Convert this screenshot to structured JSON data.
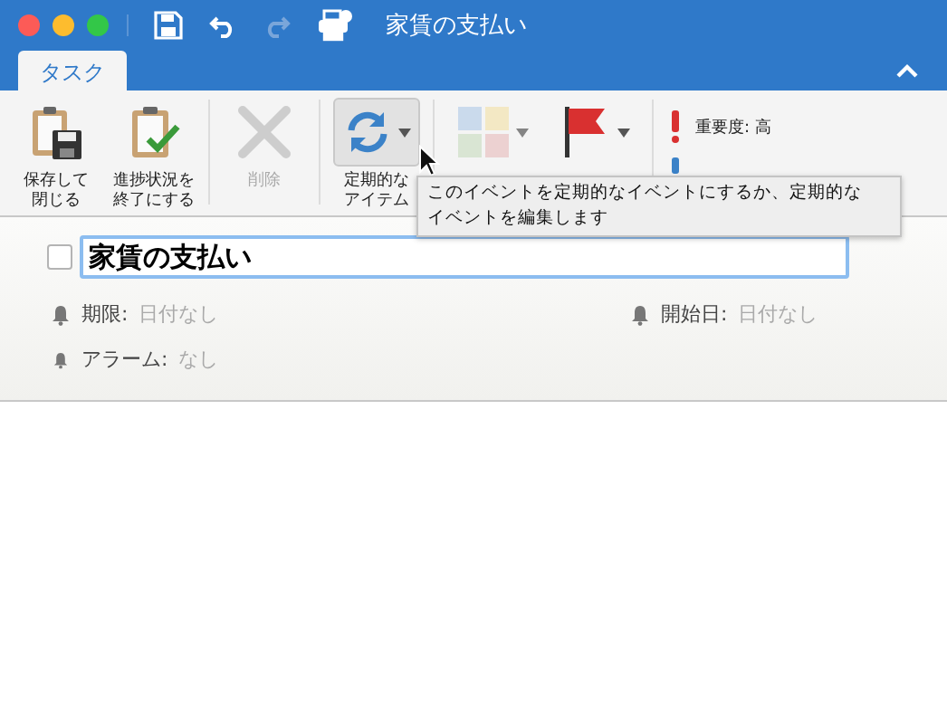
{
  "window": {
    "title": "家賃の支払い"
  },
  "quick_access": [
    {
      "kind": "save",
      "disabled": false
    },
    {
      "kind": "undo",
      "disabled": false
    },
    {
      "kind": "redo",
      "disabled": true
    },
    {
      "kind": "print",
      "disabled": false
    }
  ],
  "tabs": [
    {
      "label": "タスク",
      "selected": true
    }
  ],
  "ribbon": [
    {
      "kind": "save-close",
      "lines": [
        "保存して",
        "閉じる"
      ],
      "disabled": false,
      "pressed": false,
      "has_menu": false
    },
    {
      "kind": "complete",
      "lines": [
        "進捗状況を",
        "終了にする"
      ],
      "disabled": false,
      "pressed": false,
      "has_menu": false
    },
    {
      "kind": "delete",
      "lines": [
        "削除"
      ],
      "disabled": true,
      "pressed": false,
      "has_menu": false
    },
    {
      "kind": "recurrence",
      "lines": [
        "定期的な",
        "アイテム"
      ],
      "disabled": false,
      "pressed": true,
      "has_menu": true
    },
    {
      "kind": "category",
      "disabled": true,
      "pressed": false,
      "has_menu": true
    },
    {
      "kind": "flag",
      "disabled": false,
      "pressed": false,
      "has_menu": true
    }
  ],
  "importance": [
    {
      "kind": "high",
      "label": "重要度: 高"
    },
    {
      "kind": "low"
    }
  ],
  "tooltip": {
    "lines": [
      "このイベントを定期的なイベントにするか、定期的な",
      "イベントを編集します"
    ]
  },
  "task": {
    "checked": false,
    "subject": "家賃の支払い"
  },
  "fields": [
    {
      "kind": "due",
      "label": "期限:",
      "value": "日付なし"
    },
    {
      "kind": "start",
      "label": "開始日:",
      "value": "日付なし"
    },
    {
      "kind": "alarm",
      "label": "アラーム:",
      "value": "なし"
    }
  ]
}
